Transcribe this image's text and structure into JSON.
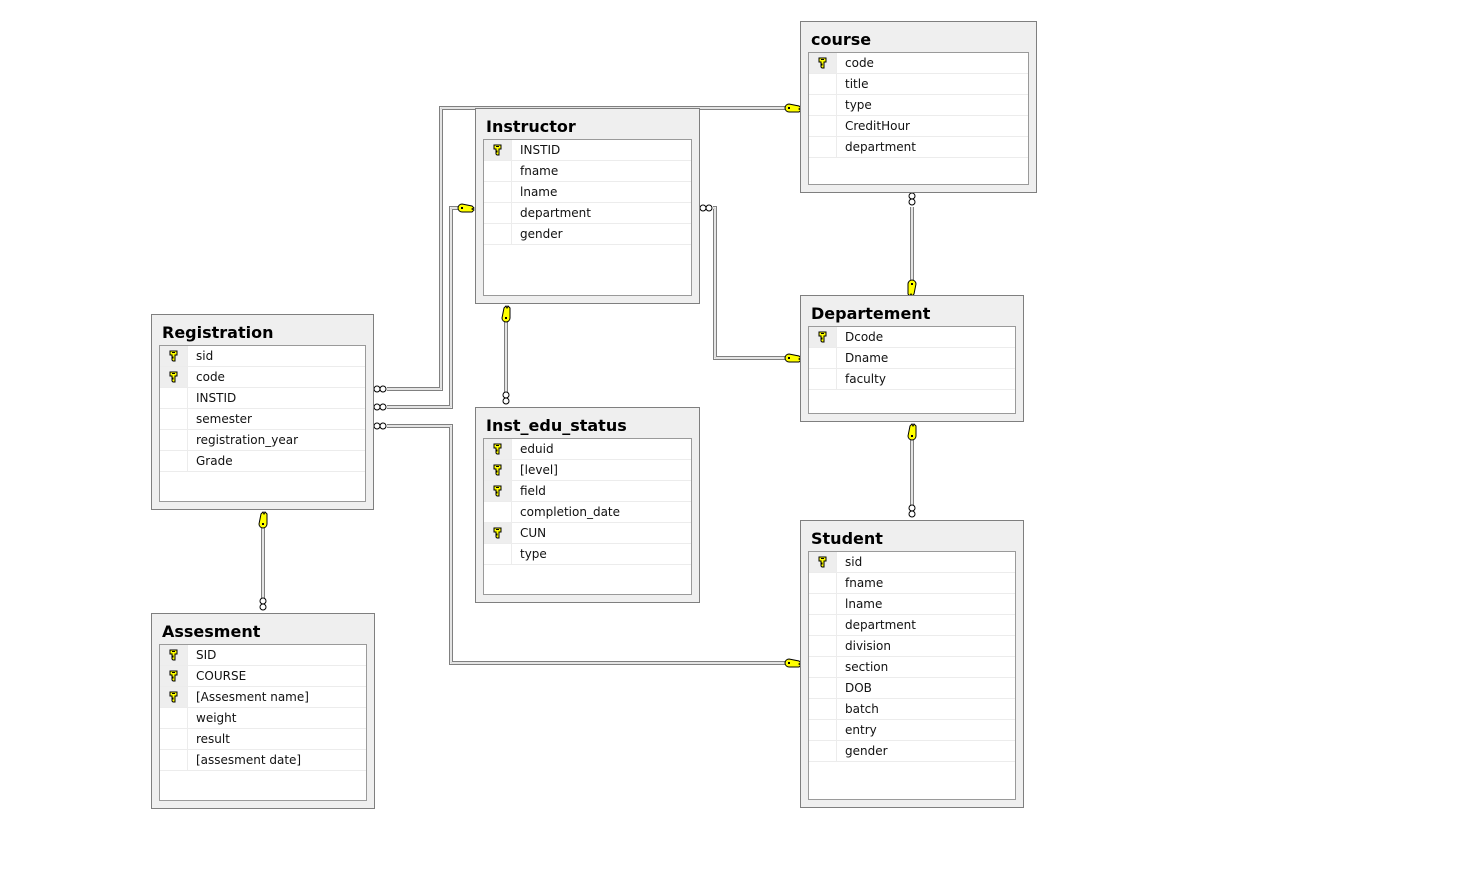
{
  "diagram": {
    "type": "database-er-diagram",
    "tables": {
      "course": {
        "name": "course",
        "columns": [
          {
            "name": "code",
            "pk": true
          },
          {
            "name": "title",
            "pk": false
          },
          {
            "name": "type",
            "pk": false
          },
          {
            "name": "CreditHour",
            "pk": false
          },
          {
            "name": "department",
            "pk": false
          }
        ]
      },
      "instructor": {
        "name": "Instructor",
        "columns": [
          {
            "name": "INSTID",
            "pk": true
          },
          {
            "name": "fname",
            "pk": false
          },
          {
            "name": "lname",
            "pk": false
          },
          {
            "name": "department",
            "pk": false
          },
          {
            "name": "gender",
            "pk": false
          }
        ]
      },
      "registration": {
        "name": "Registration",
        "columns": [
          {
            "name": "sid",
            "pk": true
          },
          {
            "name": "code",
            "pk": true
          },
          {
            "name": "INSTID",
            "pk": false
          },
          {
            "name": "semester",
            "pk": false
          },
          {
            "name": "registration_year",
            "pk": false
          },
          {
            "name": "Grade",
            "pk": false
          }
        ]
      },
      "inst_edu_status": {
        "name": "Inst_edu_status",
        "columns": [
          {
            "name": "eduid",
            "pk": true
          },
          {
            "name": "[level]",
            "pk": true
          },
          {
            "name": "field",
            "pk": true
          },
          {
            "name": "completion_date",
            "pk": false
          },
          {
            "name": "CUN",
            "pk": true
          },
          {
            "name": "type",
            "pk": false
          }
        ]
      },
      "departement": {
        "name": "Departement",
        "columns": [
          {
            "name": "Dcode",
            "pk": true
          },
          {
            "name": "Dname",
            "pk": false
          },
          {
            "name": "faculty",
            "pk": false
          }
        ]
      },
      "student": {
        "name": "Student",
        "columns": [
          {
            "name": "sid",
            "pk": true
          },
          {
            "name": "fname",
            "pk": false
          },
          {
            "name": "lname",
            "pk": false
          },
          {
            "name": "department",
            "pk": false
          },
          {
            "name": "division",
            "pk": false
          },
          {
            "name": "section",
            "pk": false
          },
          {
            "name": "DOB",
            "pk": false
          },
          {
            "name": "batch",
            "pk": false
          },
          {
            "name": "entry",
            "pk": false
          },
          {
            "name": "gender",
            "pk": false
          }
        ]
      },
      "assesment": {
        "name": "Assesment",
        "columns": [
          {
            "name": "SID",
            "pk": true
          },
          {
            "name": "COURSE",
            "pk": true
          },
          {
            "name": "[Assesment name]",
            "pk": true
          },
          {
            "name": "weight",
            "pk": false
          },
          {
            "name": "result",
            "pk": false
          },
          {
            "name": "[assesment date]",
            "pk": false
          }
        ]
      }
    },
    "relationships": [
      {
        "id": "registration-course",
        "many": "Registration",
        "one": "course"
      },
      {
        "id": "registration-instructor",
        "many": "Registration",
        "one": "Instructor"
      },
      {
        "id": "registration-student",
        "many": "Registration",
        "one": "Student"
      },
      {
        "id": "instructor-departement",
        "many": "Instructor",
        "one": "Departement"
      },
      {
        "id": "course-departement",
        "many": "course",
        "one": "Departement"
      },
      {
        "id": "student-departement",
        "many": "Student",
        "one": "Departement"
      },
      {
        "id": "inst_edu_status-instructor",
        "many": "Inst_edu_status",
        "one": "Instructor"
      },
      {
        "id": "assesment-registration",
        "many": "Assesment",
        "one": "Registration"
      }
    ],
    "colors": {
      "key_fill": "#ffff00",
      "key_outline": "#000000",
      "line_dark": "#808080",
      "line_light": "#c8c8c8"
    }
  }
}
